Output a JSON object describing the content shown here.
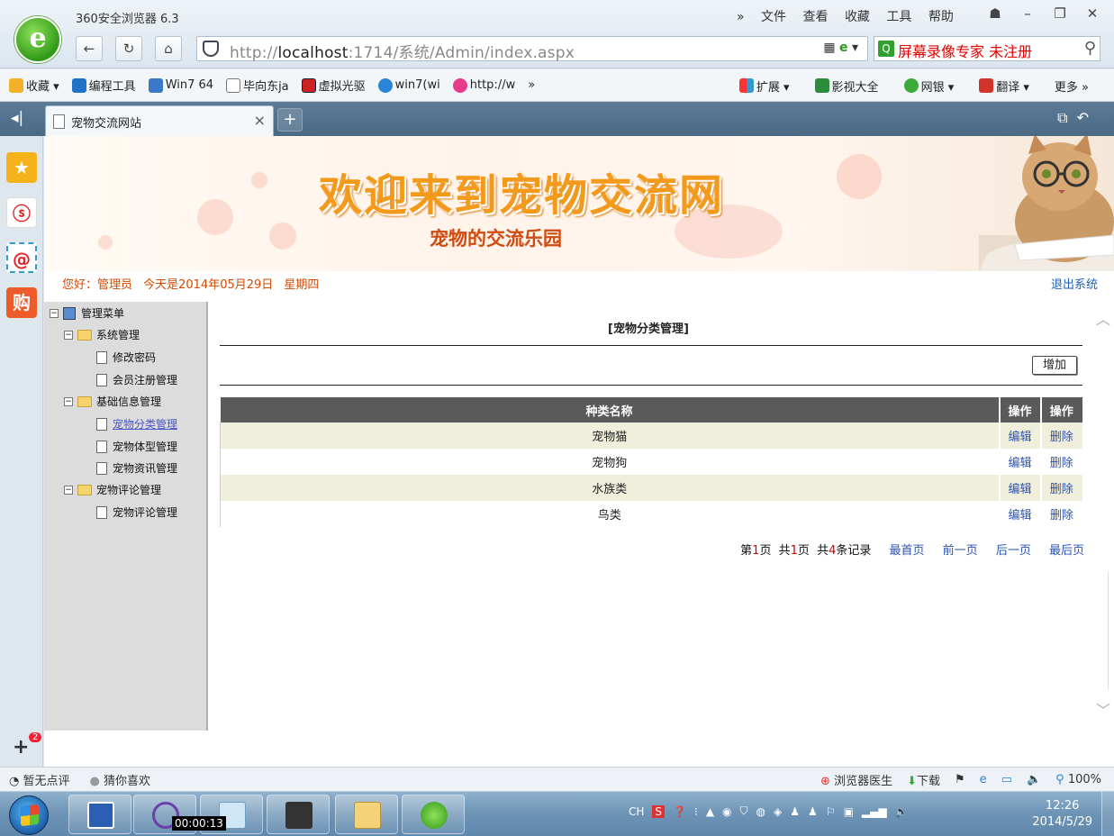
{
  "browser": {
    "app_title": "360安全浏览器 6.3",
    "menu": [
      "»",
      "文件",
      "查看",
      "收藏",
      "工具",
      "帮助"
    ],
    "url_prefix": "http://",
    "url_host": "localhost",
    "url_rest": ":1714/系统/Admin/index.aspx",
    "search_text": "屏幕录像专家 未注册",
    "bookmarks_left": [
      "收藏 ▾",
      "编程工具",
      "Win7 64",
      "毕向东ja",
      "虚拟光驱",
      "win7(wi",
      "http://w",
      "»"
    ],
    "bookmarks_right": [
      "扩展 ▾",
      "影视大全",
      "网银 ▾",
      "翻译 ▾",
      "更多 »"
    ],
    "tab_label": "宠物交流网站",
    "tab_close": "×",
    "new_tab": "+"
  },
  "site": {
    "banner_title": "欢迎来到宠物交流网",
    "banner_subtitle": "宠物的交流乐园",
    "welcome": "您好：管理员 今天是2014年05月29日 星期四",
    "logout": "退出系统"
  },
  "tree": {
    "root": "管理菜单",
    "system": "系统管理",
    "change_password": "修改密码",
    "member_register": "会员注册管理",
    "basic_info": "基础信息管理",
    "pet_category": "宠物分类管理",
    "pet_body_type": "宠物体型管理",
    "pet_news": "宠物资讯管理",
    "pet_comments_group": "宠物评论管理",
    "pet_comments": "宠物评论管理"
  },
  "main": {
    "heading": "[宠物分类管理]",
    "add_button": "增加",
    "columns": [
      "种类名称",
      "操作",
      "操作"
    ],
    "rows": [
      {
        "name": "宠物猫",
        "edit": "编辑",
        "delete": "删除"
      },
      {
        "name": "宠物狗",
        "edit": "编辑",
        "delete": "删除"
      },
      {
        "name": "水族类",
        "edit": "编辑",
        "delete": "删除"
      },
      {
        "name": "鸟类",
        "edit": "编辑",
        "delete": "删除"
      }
    ],
    "pager": {
      "page_prefix": "第",
      "page_num": "1",
      "page_suffix": "页",
      "total_prefix": "共",
      "total_pages": "1",
      "total_suffix": "页",
      "records_prefix": "共",
      "records": "4",
      "records_suffix": "条记录",
      "first": "最首页",
      "prev": "前一页",
      "next": "后一页",
      "last": "最后页"
    }
  },
  "statusbar": {
    "left": [
      "暂无点评",
      "猜你喜欢"
    ],
    "right": [
      "浏览器医生",
      "下载",
      "100%"
    ]
  },
  "taskbar": {
    "recording_time": "00:00:13",
    "lang": "CH",
    "clock_time": "12:26",
    "clock_date": "2014/5/29"
  },
  "colors": {
    "banner_title": "#f39a1d",
    "welcome_text": "#d34a00",
    "grid_header": "#5a5a5a",
    "grid_alt_row": "#efefdc",
    "link_blue": "#2b52b8"
  }
}
